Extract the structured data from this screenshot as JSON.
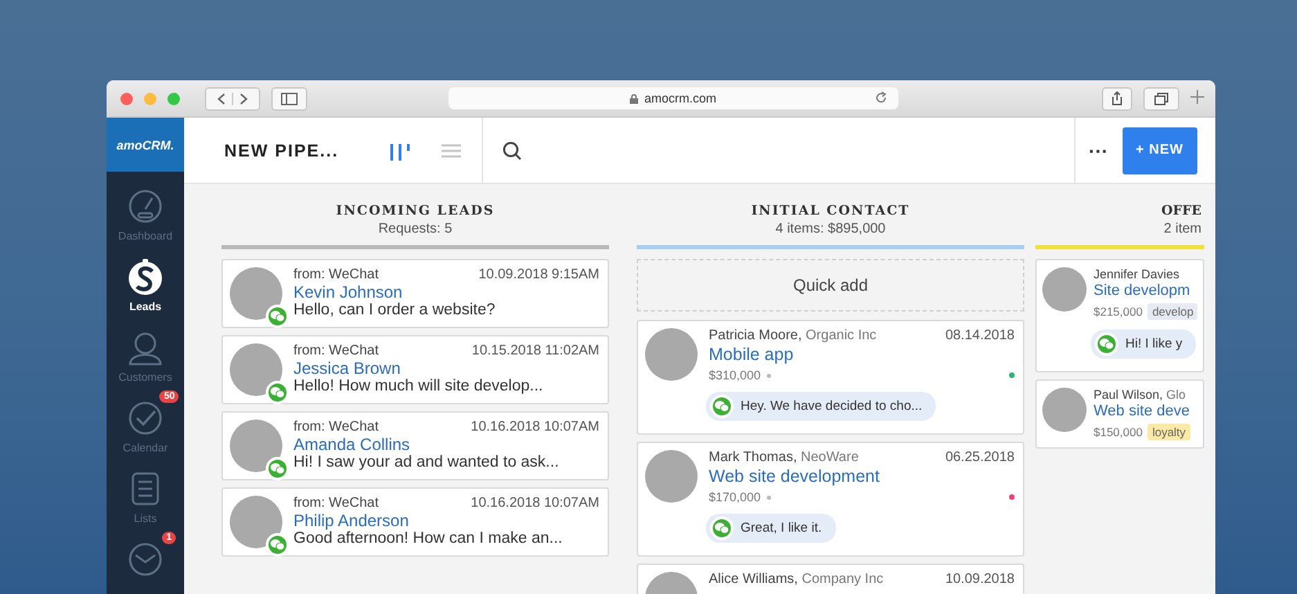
{
  "browser": {
    "url": "amocrm.com"
  },
  "app": {
    "logo": "amoCRM.",
    "title": "NEW PIPE...",
    "more": "···",
    "new_button": "+ NEW"
  },
  "view_toggle": [
    {
      "kind": "pipeline",
      "selected": true
    },
    {
      "kind": "list",
      "selected": false
    }
  ],
  "sidebar": {
    "items": [
      {
        "kind": "dashboard",
        "label": "Dashboard",
        "selected": false
      },
      {
        "kind": "leads",
        "label": "Leads",
        "selected": true
      },
      {
        "kind": "customers",
        "label": "Customers",
        "selected": false
      },
      {
        "kind": "calendar",
        "label": "Calendar",
        "selected": false,
        "badge": "50"
      },
      {
        "kind": "lists",
        "label": "Lists",
        "selected": false
      },
      {
        "kind": "mail",
        "selected": false,
        "badge": "1"
      }
    ]
  },
  "columns": [
    {
      "kind": "incoming",
      "title": "INCOMING LEADS",
      "subtitle": "Requests: 5",
      "color": "#b9b9b9",
      "cards": [
        {
          "source": "from: WeChat",
          "time": "10.09.2018 9:15AM",
          "name": "Kevin Johnson",
          "message": "Hello, can I order a website?"
        },
        {
          "source": "from: WeChat",
          "time": "10.15.2018 11:02AM",
          "name": "Jessica Brown",
          "message": "Hello! How much will site develop..."
        },
        {
          "source": "from: WeChat",
          "time": "10.16.2018 10:07AM",
          "name": "Amanda Collins",
          "message": "Hi! I saw your ad and wanted to ask..."
        },
        {
          "source": "from: WeChat",
          "time": "10.16.2018 10:07AM",
          "name": "Philip Anderson",
          "message": "Good afternoon! How can I make an..."
        }
      ]
    },
    {
      "kind": "deals",
      "title": "INITIAL CONTACT",
      "subtitle": "4 items: $895,000",
      "color": "#a9cdf0",
      "quick_add": "Quick add",
      "cards": [
        {
          "contact": "Patricia Moore,",
          "company": "Organic Inc",
          "date": "08.14.2018",
          "title": "Mobile app",
          "price": "$310,000",
          "color": "#2bb673",
          "message": "Hey. We have decided to cho..."
        },
        {
          "contact": "Mark Thomas,",
          "company": "NeoWare",
          "date": "06.25.2018",
          "title": "Web site development",
          "price": "$170,000",
          "color": "#e8457a",
          "message": "Great, I like it."
        },
        {
          "contact": "Alice Williams,",
          "company": "Company Inc",
          "date": "10.09.2018"
        }
      ]
    },
    {
      "kind": "deals",
      "title": "OFFE",
      "subtitle": "2 item",
      "color": "#f0e23a",
      "cards": [
        {
          "contact": "Jennifer Davies",
          "title": "Site developm",
          "price": "$215,000",
          "tag": {
            "text": "develop",
            "color": "#e6ebf3"
          },
          "message": "Hi! I like y"
        },
        {
          "contact": "Paul Wilson,",
          "company": "Glo",
          "title": "Web site deve",
          "price": "$150,000",
          "tag": {
            "text": "loyalty",
            "color": "#fbe9a6"
          }
        }
      ]
    }
  ]
}
